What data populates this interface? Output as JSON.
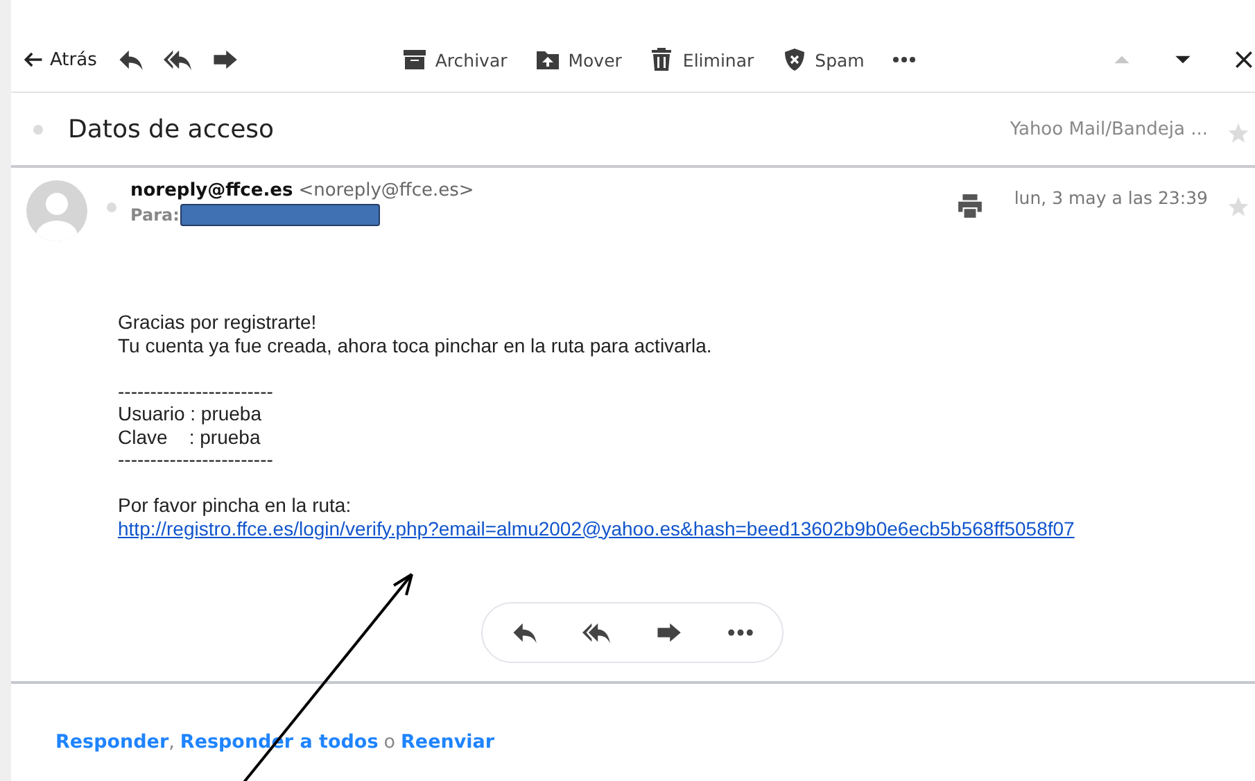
{
  "toolbar": {
    "back": {
      "label": "Atrás"
    },
    "actions": [
      {
        "kind": "reply"
      },
      {
        "kind": "reply_all"
      },
      {
        "kind": "forward"
      }
    ],
    "tools": [
      {
        "kind": "archive",
        "label": "Archivar"
      },
      {
        "kind": "move",
        "label": "Mover"
      },
      {
        "kind": "delete",
        "label": "Eliminar"
      },
      {
        "kind": "spam",
        "label": "Spam"
      },
      {
        "kind": "more"
      }
    ],
    "nav": [
      {
        "kind": "up",
        "disabled": true
      },
      {
        "kind": "down",
        "disabled": false
      },
      {
        "kind": "close",
        "disabled": false
      }
    ]
  },
  "subject": {
    "title": "Datos de acceso",
    "folder": "Yahoo Mail/Bandeja ...",
    "starred": false
  },
  "message": {
    "sender": "noreply@ffce.es",
    "address": "<noreply@ffce.es>",
    "to_label": "Para:",
    "redacted": true,
    "date": "lun, 3 may a las 23:39",
    "starred": false,
    "body": [
      {
        "kind": "text",
        "text": "Gracias por registrarte!"
      },
      {
        "kind": "text",
        "text": "Tu cuenta ya fue creada, ahora toca pinchar en la ruta para activarla."
      },
      {
        "kind": "blank"
      },
      {
        "kind": "text",
        "text": "------------------------"
      },
      {
        "kind": "text",
        "text": "Usuario : prueba"
      },
      {
        "kind": "text",
        "text": "Clave    : prueba"
      },
      {
        "kind": "text",
        "text": "------------------------"
      },
      {
        "kind": "blank"
      },
      {
        "kind": "text",
        "text": "Por favor pincha en la ruta:"
      },
      {
        "kind": "link",
        "text": "http://registro.ffce.es/login/verify.php?email=almu2002@yahoo.es&hash=beed13602b9b0e6ecb5b568ff5058f07"
      }
    ],
    "quick_actions": [
      {
        "kind": "reply"
      },
      {
        "kind": "reply_all"
      },
      {
        "kind": "forward"
      },
      {
        "kind": "more"
      }
    ]
  },
  "footer": [
    {
      "kind": "link",
      "text": "Responder"
    },
    {
      "kind": "sep",
      "text": ","
    },
    {
      "kind": "link",
      "text": "Responder a todos"
    },
    {
      "kind": "sep",
      "text": "o"
    },
    {
      "kind": "link",
      "text": "Reenviar"
    }
  ],
  "annotation": {
    "kind": "arrow"
  }
}
